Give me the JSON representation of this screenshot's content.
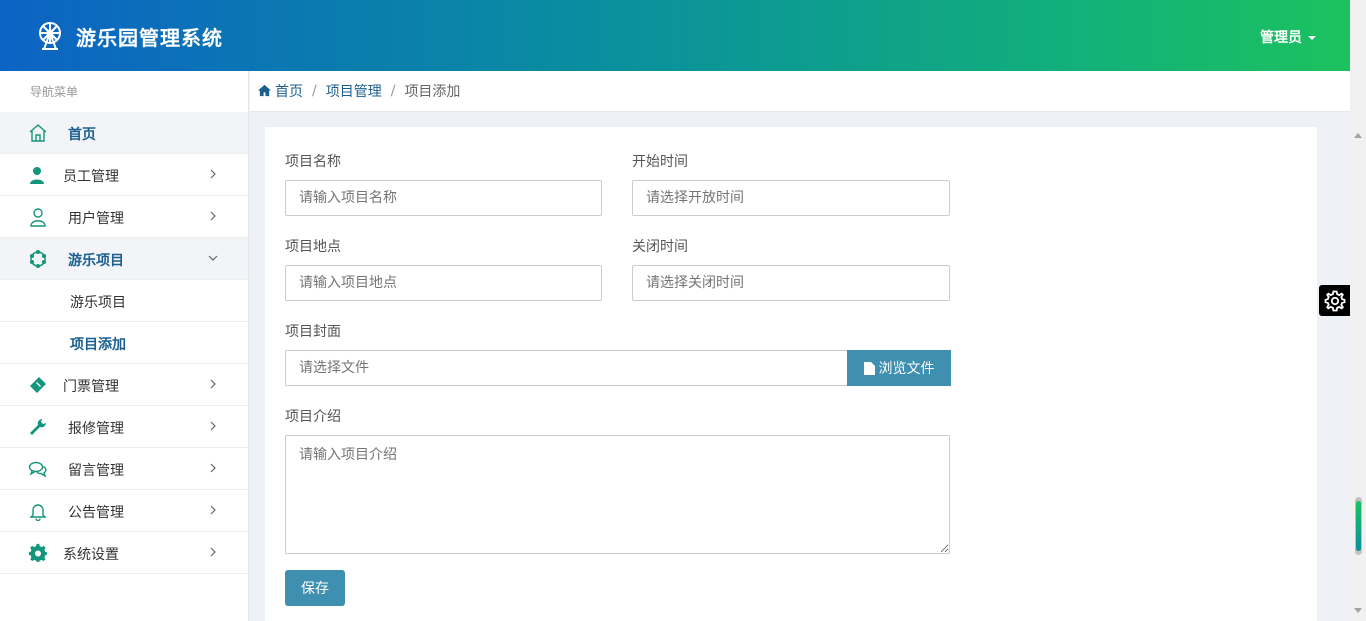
{
  "header": {
    "title": "游乐园管理系统",
    "user_label": "管理员"
  },
  "sidebar": {
    "heading": "导航菜单",
    "items": [
      {
        "label": "首页",
        "icon": "home-icon"
      },
      {
        "label": "员工管理",
        "icon": "user-solid-icon"
      },
      {
        "label": "用户管理",
        "icon": "user-outline-icon"
      },
      {
        "label": "游乐项目",
        "icon": "ferris-wheel-icon"
      },
      {
        "label": "游乐项目"
      },
      {
        "label": "项目添加"
      },
      {
        "label": "门票管理",
        "icon": "ticket-icon"
      },
      {
        "label": "报修管理",
        "icon": "wrench-icon"
      },
      {
        "label": "留言管理",
        "icon": "comments-icon"
      },
      {
        "label": "公告管理",
        "icon": "bell-icon"
      },
      {
        "label": "系统设置",
        "icon": "gear-icon"
      }
    ]
  },
  "breadcrumb": {
    "home": "首页",
    "parent": "项目管理",
    "current": "项目添加",
    "separator": "/"
  },
  "form": {
    "name_label": "项目名称",
    "name_placeholder": "请输入项目名称",
    "start_label": "开始时间",
    "start_placeholder": "请选择开放时间",
    "location_label": "项目地点",
    "location_placeholder": "请输入项目地点",
    "end_label": "关闭时间",
    "end_placeholder": "请选择关闭时间",
    "cover_label": "项目封面",
    "cover_placeholder": "请选择文件",
    "browse_label": "浏览文件",
    "intro_label": "项目介绍",
    "intro_placeholder": "请输入项目介绍",
    "save_label": "保存"
  },
  "colors": {
    "accent": "#3e8fb0",
    "nav_active": "#1b5f8f",
    "icon_teal": "#14967c"
  }
}
